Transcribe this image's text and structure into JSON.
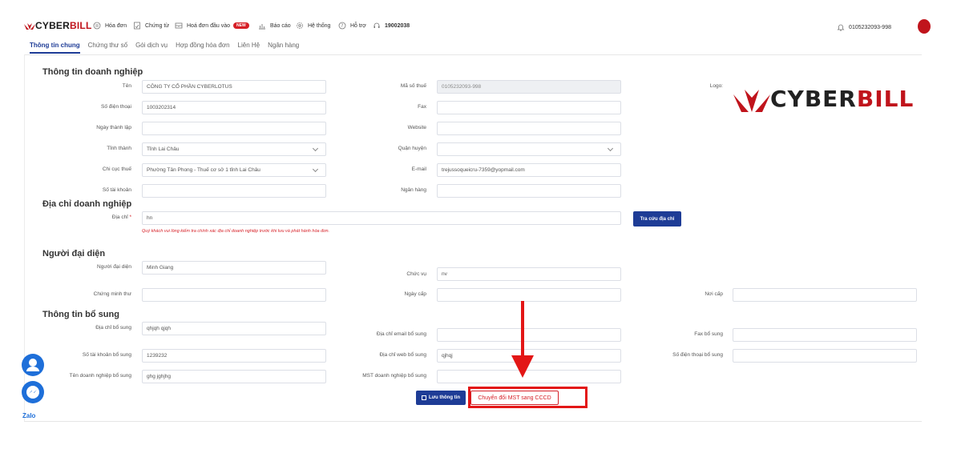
{
  "nav": {
    "brand_cyber": "CYBER",
    "brand_bill": "BILL",
    "items": [
      {
        "label": "Hóa đơn",
        "icon": "invoice-icon"
      },
      {
        "label": "Chứng từ",
        "icon": "document-icon"
      },
      {
        "label": "Hoá đơn đầu vào",
        "icon": "inbox-icon",
        "badge": "NEW"
      },
      {
        "label": "Báo cáo",
        "icon": "chart-icon"
      },
      {
        "label": "Hệ thống",
        "icon": "gear-icon"
      },
      {
        "label": "Hỗ trợ",
        "icon": "help-icon"
      },
      {
        "label": "19002038",
        "icon": "headset-icon"
      }
    ],
    "account": "0105232093-998"
  },
  "tabs": [
    "Thông tin chung",
    "Chứng thư số",
    "Gói dịch vụ",
    "Hợp đồng hóa đơn",
    "Liên Hệ",
    "Ngân hàng"
  ],
  "sections": {
    "company": "Thông tin doanh nghiệp",
    "address": "Địa chỉ doanh nghiệp",
    "rep": "Người đại diện",
    "extra": "Thông tin bổ sung"
  },
  "form": {
    "ten": {
      "label": "Tên",
      "value": "CÔNG TY CỔ PHẦN CYBERLOTUS"
    },
    "mst": {
      "label": "Mã số thuế",
      "value": "0105232093-998"
    },
    "logo": {
      "label": "Logo:"
    },
    "sdt": {
      "label": "Số điện thoại",
      "value": "1003202314"
    },
    "fax": {
      "label": "Fax",
      "value": ""
    },
    "ngay_tl": {
      "label": "Ngày thành lập",
      "value": ""
    },
    "website": {
      "label": "Website",
      "value": ""
    },
    "tinh": {
      "label": "Tỉnh thành",
      "value": "Tỉnh Lai Châu"
    },
    "quan": {
      "label": "Quận huyện",
      "value": ""
    },
    "chicuc": {
      "label": "Chi cục thuế",
      "value": "Phường Tân Phong - Thuế cơ sở 1 tỉnh Lai Châu"
    },
    "email": {
      "label": "E-mail",
      "value": "trejussoqueicru-7359@yopmail.com"
    },
    "stk": {
      "label": "Số tài khoản",
      "value": ""
    },
    "nganhang": {
      "label": "Ngân hàng",
      "value": ""
    },
    "diachi": {
      "label": "Địa chỉ",
      "req": "*",
      "value": "hn"
    },
    "warning": "Quý khách vui lòng kiểm tra chính xác địa chỉ doanh nghiệp trước khi lưu và phát hành hóa đơn.",
    "lookup_btn": "Tra cứu địa chỉ",
    "ndd": {
      "label": "Người đại diện",
      "value": "Minh Giang"
    },
    "chucvu": {
      "label": "Chức vụ",
      "value": "nv"
    },
    "cmt": {
      "label": "Chứng minh thư",
      "value": ""
    },
    "ngaycap": {
      "label": "Ngày cấp",
      "value": ""
    },
    "noicap": {
      "label": "Nơi cấp",
      "value": ""
    },
    "dcbs": {
      "label": "Địa chỉ bổ sung",
      "value": "qhjqh qjqh"
    },
    "emailbs": {
      "label": "Địa chỉ email bổ sung",
      "value": ""
    },
    "faxbs": {
      "label": "Fax bổ sung",
      "value": ""
    },
    "stkbs": {
      "label": "Số tài khoản bổ sung",
      "value": "1239232"
    },
    "webbs": {
      "label": "Địa chỉ web bổ sung",
      "value": "qjhqj"
    },
    "sdtbs": {
      "label": "Số điện thoại bổ sung",
      "value": ""
    },
    "tendnbs": {
      "label": "Tên doanh nghiệp bổ sung",
      "value": "ghg jghjhg"
    },
    "mstbs": {
      "label": "MST doanh nghiệp bổ sung",
      "value": ""
    }
  },
  "actions": {
    "save": "Lưu thông tin",
    "convert": "Chuyển đổi MST sang CCCD"
  },
  "logo": {
    "cyber": "CYBER",
    "bill": "BILL"
  },
  "zalo": "Zalo",
  "colors": {
    "primary": "#1e3c96",
    "brand_red": "#c0141c",
    "annotation_red": "#e31616"
  }
}
